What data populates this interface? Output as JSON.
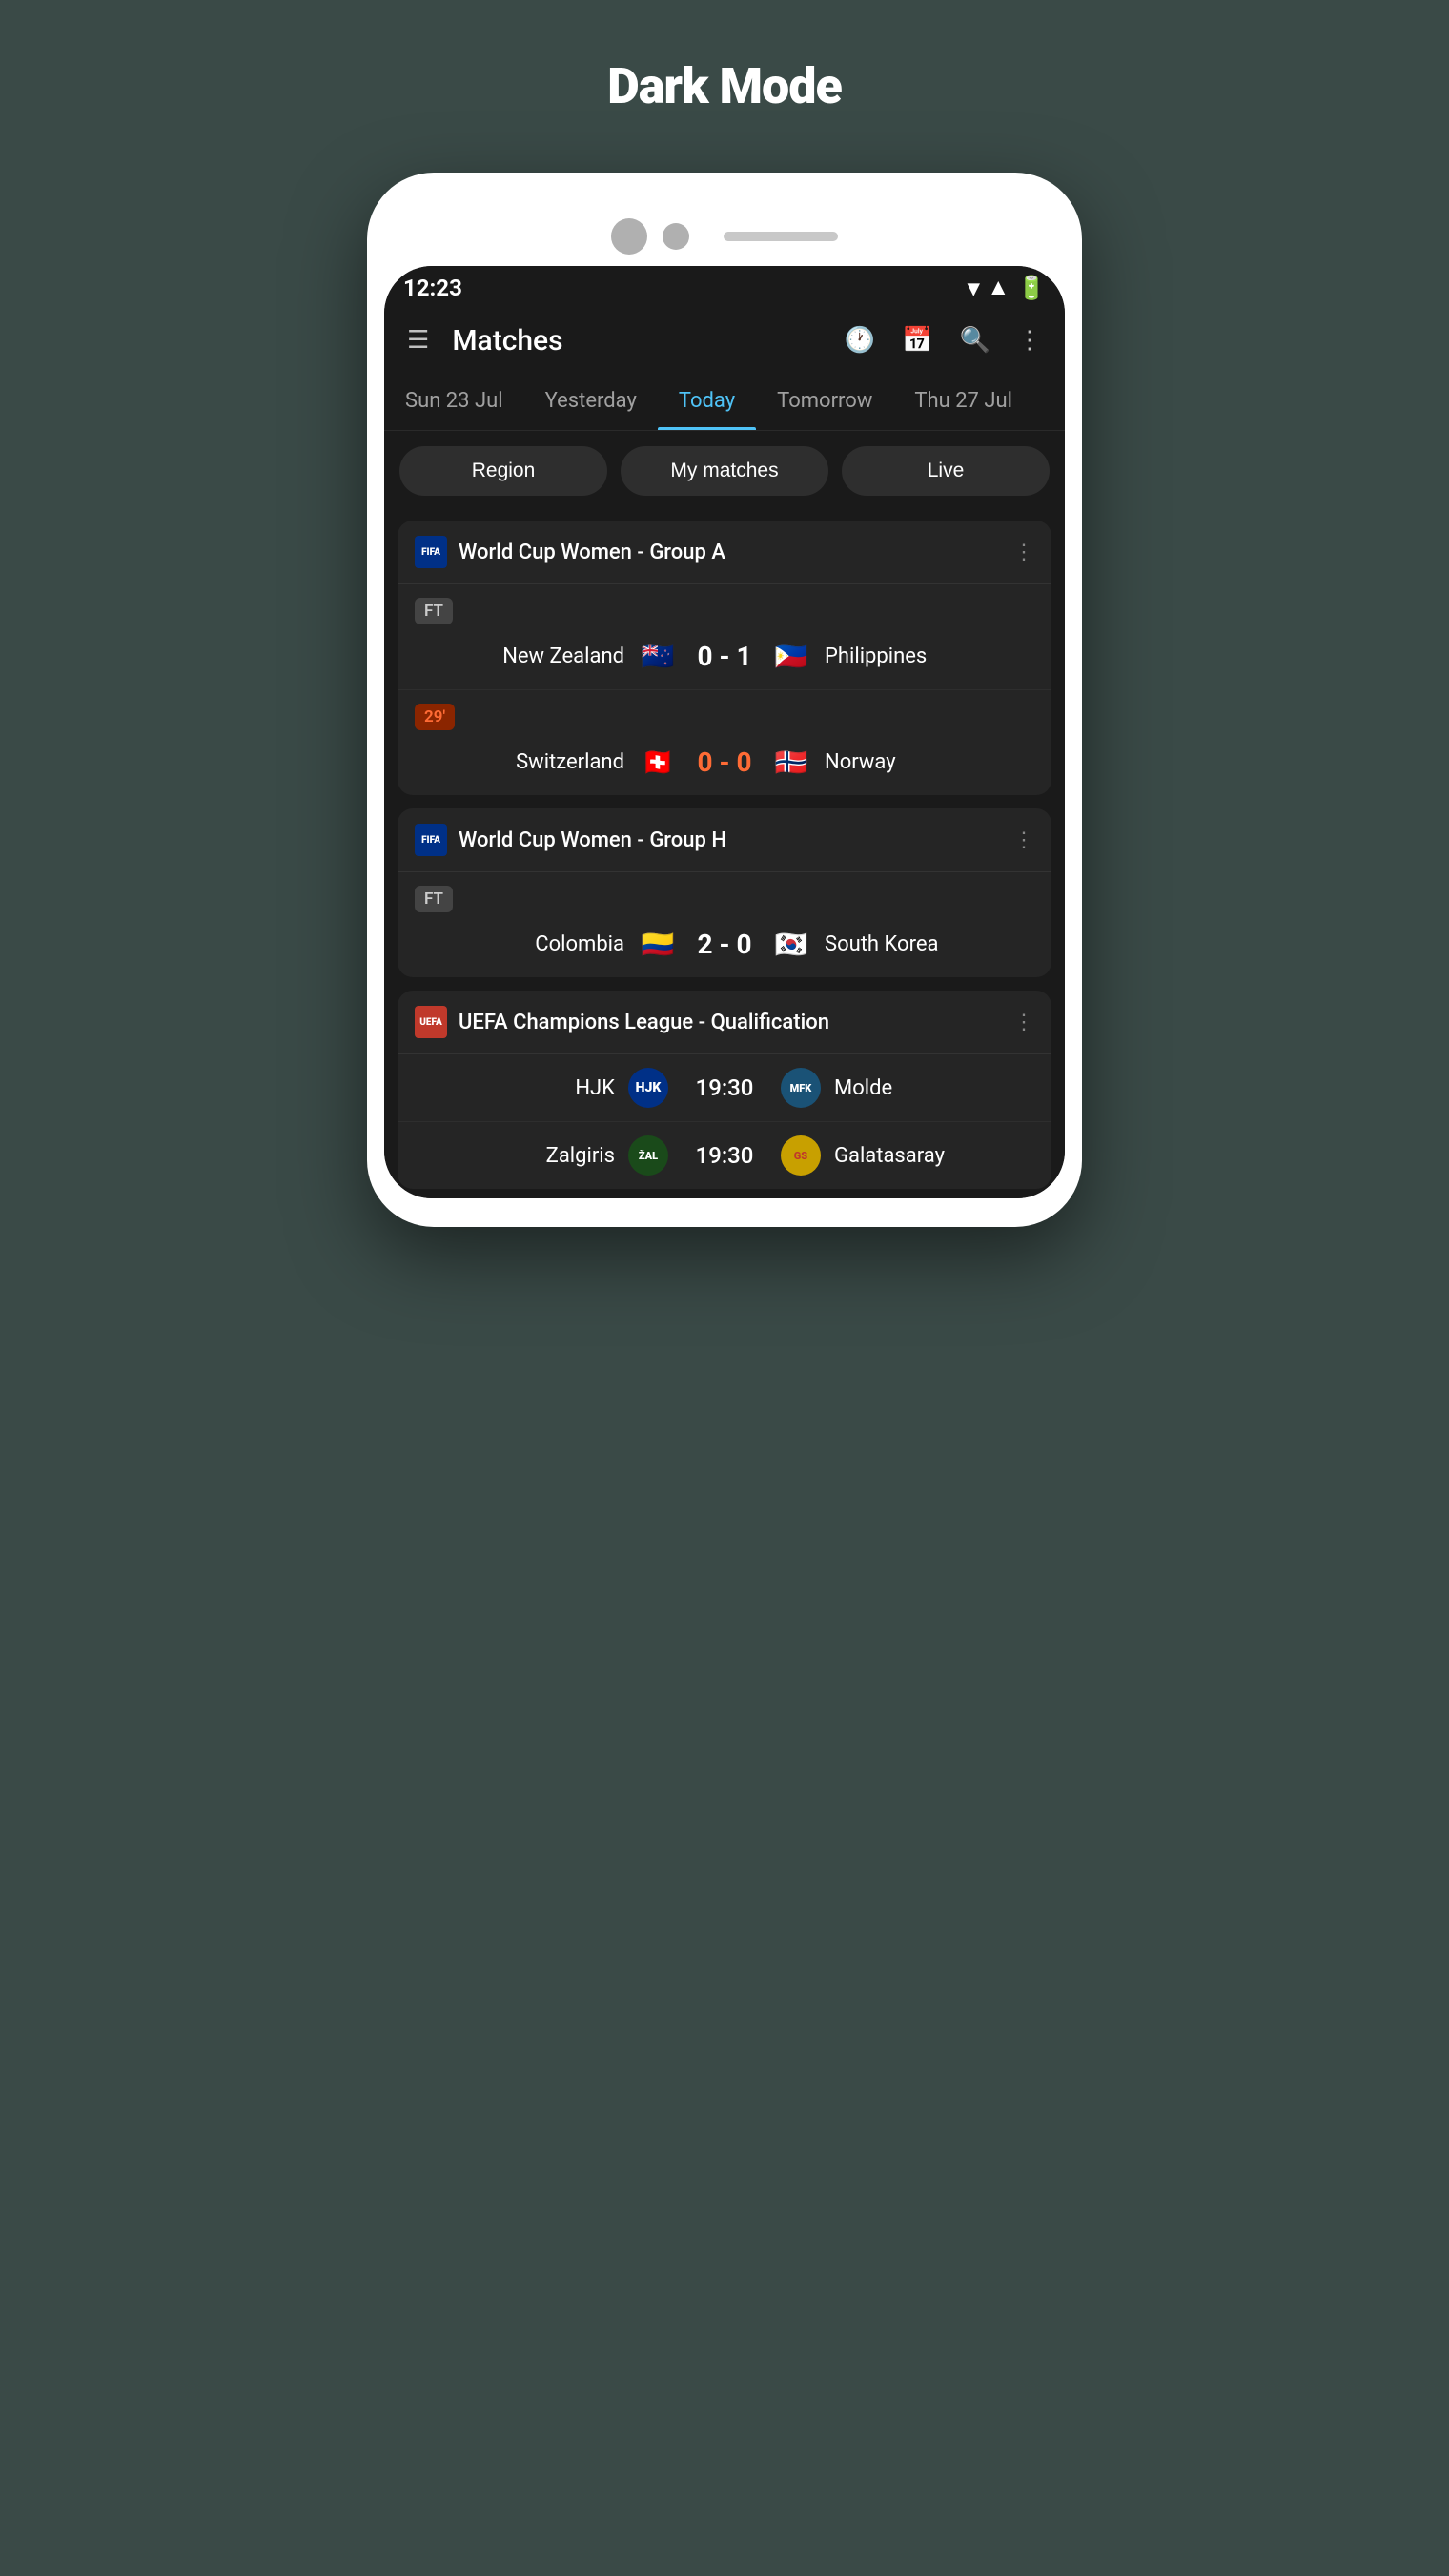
{
  "page": {
    "title": "Dark Mode",
    "background_color": "#3a4a47"
  },
  "status_bar": {
    "time": "12:23",
    "wifi_icon": "wifi",
    "signal_icon": "signal",
    "battery_icon": "battery"
  },
  "app_bar": {
    "menu_icon": "menu",
    "title": "Matches",
    "history_icon": "history",
    "calendar_icon": "calendar",
    "search_icon": "search",
    "more_icon": "more-vertical"
  },
  "date_tabs": [
    {
      "label": "Sun 23 Jul",
      "active": false
    },
    {
      "label": "Yesterday",
      "active": false
    },
    {
      "label": "Today",
      "active": true
    },
    {
      "label": "Tomorrow",
      "active": false
    },
    {
      "label": "Thu 27 Jul",
      "active": false
    }
  ],
  "filter_buttons": [
    {
      "label": "Region"
    },
    {
      "label": "My matches"
    },
    {
      "label": "Live"
    }
  ],
  "match_groups": [
    {
      "id": "group-a",
      "league_icon": "FIFA",
      "title": "World Cup Women - Group A",
      "matches": [
        {
          "status": "FT",
          "status_type": "ft",
          "home_team": "New Zealand",
          "home_flag": "🇳🇿",
          "score": "0 - 1",
          "away_team": "Philippines",
          "away_flag": "🇵🇭",
          "score_type": "normal"
        },
        {
          "status": "29'",
          "status_type": "live",
          "home_team": "Switzerland",
          "home_flag": "🇨🇭",
          "score": "0 - 0",
          "away_team": "Norway",
          "away_flag": "🇳🇴",
          "score_type": "live"
        }
      ]
    },
    {
      "id": "group-h",
      "league_icon": "FIFA",
      "title": "World Cup Women - Group H",
      "matches": [
        {
          "status": "FT",
          "status_type": "ft",
          "home_team": "Colombia",
          "home_flag": "🇨🇴",
          "score": "2 - 0",
          "away_team": "South Korea",
          "away_flag": "🇰🇷",
          "score_type": "normal"
        }
      ]
    },
    {
      "id": "champions-league",
      "league_icon": "UEFA",
      "title": "UEFA Champions League - Qualification",
      "matches": [
        {
          "status": "19:30",
          "status_type": "time",
          "home_team": "HJK",
          "home_club_color": "#003087",
          "home_icon": "⚽",
          "away_team": "Molde",
          "away_club_color": "#1a5276",
          "away_icon": "⚽",
          "score": "19:30",
          "score_type": "time"
        },
        {
          "status": "19:30",
          "status_type": "time",
          "home_team": "Zalgiris",
          "home_club_color": "#1a4a1a",
          "home_icon": "⚽",
          "away_team": "Galatasaray",
          "away_club_color": "#8B4513",
          "away_icon": "⚽",
          "score": "19:30",
          "score_type": "time"
        }
      ]
    }
  ]
}
